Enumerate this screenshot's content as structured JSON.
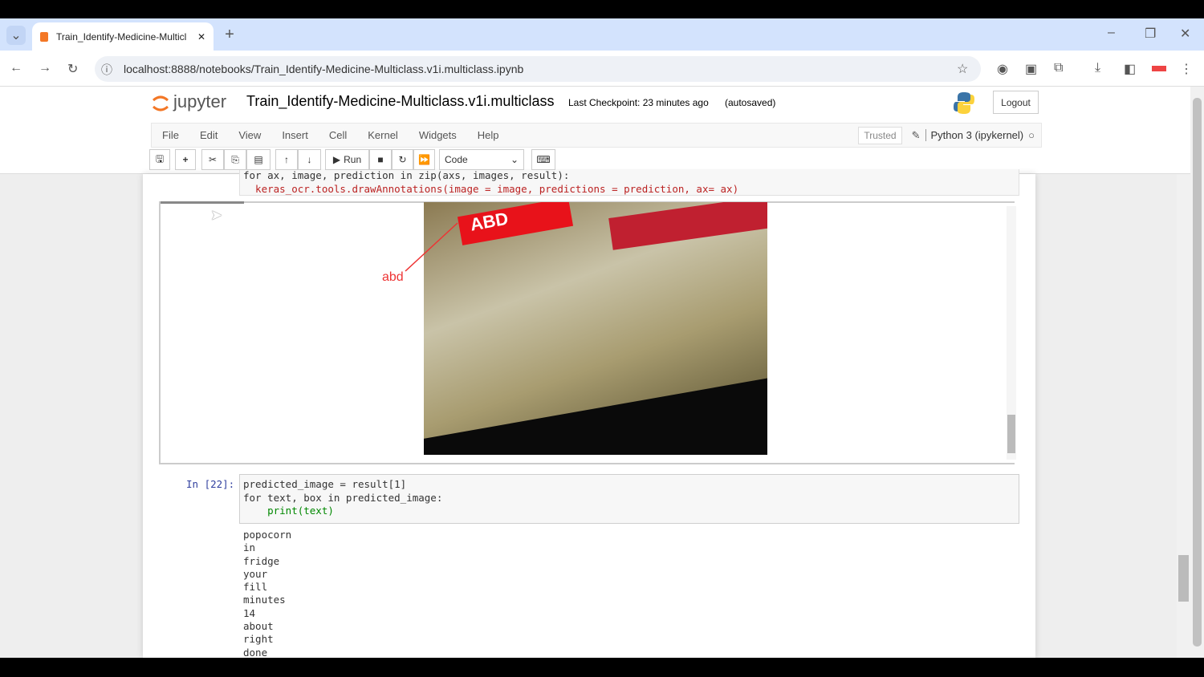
{
  "browser": {
    "tab_title": "Train_Identify-Medicine-Multicl",
    "url": "localhost:8888/notebooks/Train_Identify-Medicine-Multiclass.v1i.multiclass.ipynb"
  },
  "jupyter": {
    "logo": "jupyter",
    "notebook_name": "Train_Identify-Medicine-Multiclass.v1i.multiclass",
    "checkpoint": "Last Checkpoint: 23 minutes ago",
    "autosaved": "(autosaved)",
    "logout": "Logout",
    "menu": [
      "File",
      "Edit",
      "View",
      "Insert",
      "Cell",
      "Kernel",
      "Widgets",
      "Help"
    ],
    "trusted": "Trusted",
    "kernel": "Python 3 (ipykernel)",
    "run_label": "Run",
    "cell_type": "Code"
  },
  "cells": {
    "prev_code": [
      "for ax, image, prediction in zip(axs, images, result):",
      "  keras_ocr.tools.drawAnnotations(image = image, predictions = prediction, ax= ax)"
    ],
    "annotation_label": "abd",
    "label_text": "ABD",
    "cell22_prompt": "In [22]:",
    "cell22_code": [
      "predicted_image = result[1]",
      "for text, box in predicted_image:",
      "    print(text)"
    ],
    "output": [
      "popocorn",
      "in",
      "fridge",
      "your",
      "fill",
      "minutes",
      "14",
      "about",
      "right",
      "done"
    ]
  }
}
